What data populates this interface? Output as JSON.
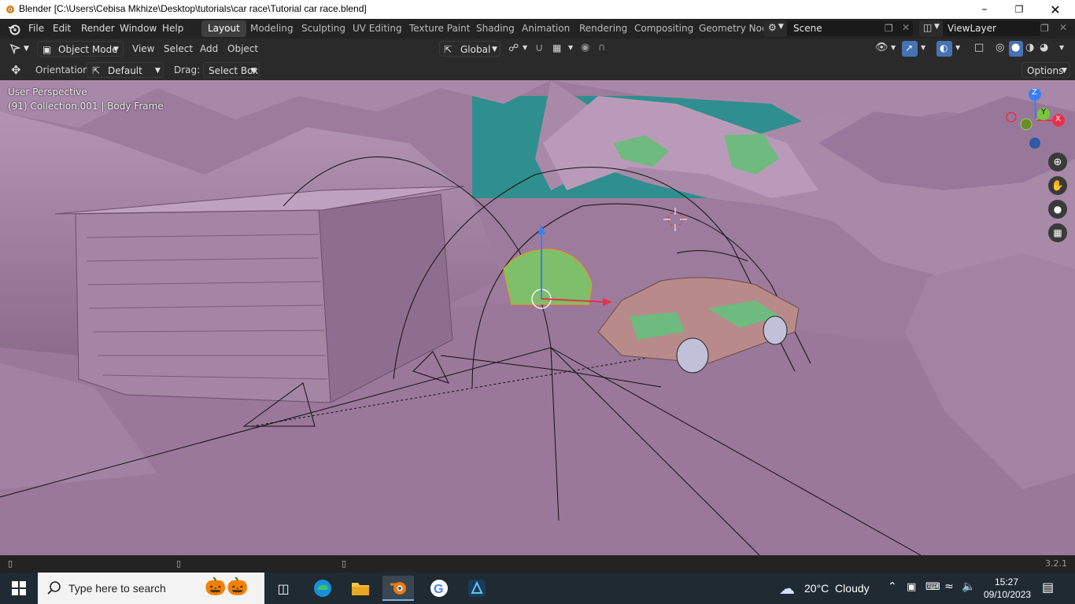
{
  "window": {
    "title": "Blender [C:\\Users\\Cebisa Mkhize\\Desktop\\tutorials\\car race\\Tutorial car race.blend]",
    "minimize_icon": "minimize-icon",
    "restore_icon": "restore-icon",
    "close_icon": "close-icon"
  },
  "topbar": {
    "menus": [
      "File",
      "Edit",
      "Render",
      "Window",
      "Help"
    ],
    "workspaces": [
      "Layout",
      "Modeling",
      "Sculpting",
      "UV Editing",
      "Texture Paint",
      "Shading",
      "Animation",
      "Rendering",
      "Compositing",
      "Geometry Noc"
    ],
    "active_workspace": "Layout",
    "scene_value": "Scene",
    "viewlayer_value": "ViewLayer"
  },
  "header": {
    "mode": "Object Mode",
    "menus": [
      "View",
      "Select",
      "Add",
      "Object"
    ],
    "transform_orientation": "Global"
  },
  "toolrow": {
    "orientation_label": "Orientation:",
    "orientation_value": "Default",
    "drag_label": "Drag:",
    "drag_value": "Select Box",
    "options_label": "Options"
  },
  "viewport": {
    "perspective_text": "User Perspective",
    "collection_text": "(91) Collection.001 | Body Frame",
    "gizmo": {
      "z": "Z",
      "y": "Y",
      "x": "X"
    },
    "colors": {
      "ground": "#9c7b9c",
      "sky": "#2f8e8e",
      "car_body": "#b88a8a",
      "foliage": "#6fba7e"
    }
  },
  "statusbar": {
    "version": "3.2.1"
  },
  "taskbar": {
    "search_placeholder": "Type here to search",
    "weather": "20°C  Cloudy",
    "time": "15:27",
    "date": "09/10/2023"
  }
}
